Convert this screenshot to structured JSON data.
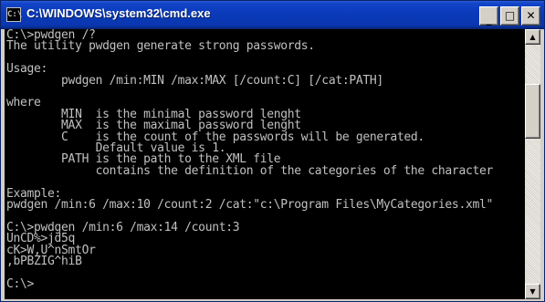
{
  "window": {
    "title": "C:\\WINDOWS\\system32\\cmd.exe",
    "icon_name": "console-app-icon",
    "icon_glyph": "C:\\"
  },
  "titlebar_buttons": {
    "minimize": "_",
    "maximize": "□",
    "close": "✕"
  },
  "console": {
    "lines": [
      "C:\\>pwdgen /?",
      "The utility pwdgen generate strong passwords.",
      "",
      "Usage:",
      "        pwdgen /min:MIN /max:MAX [/count:C] [/cat:PATH]",
      "",
      "where",
      "        MIN  is the minimal password lenght",
      "        MAX  is the maximal password lenght",
      "        C    is the count of the passwords will be generated.",
      "             Default value is 1.",
      "        PATH is the path to the XML file",
      "             contains the definition of the categories of the character",
      "",
      "Example:",
      "pwdgen /min:6 /max:10 /count:2 /cat:\"c:\\Program Files\\MyCategories.xml\"",
      "",
      "C:\\>pwdgen /min:6 /max:14 /count:3",
      "UnCD%>jd5q",
      "cK>W,U^nSmtOr",
      ",bPBZIG^hiB",
      "",
      "C:\\>"
    ],
    "text_color": "#c0c0c0",
    "background": "#000000"
  },
  "scrollbar": {
    "up_arrow": "▲",
    "down_arrow": "▼"
  }
}
